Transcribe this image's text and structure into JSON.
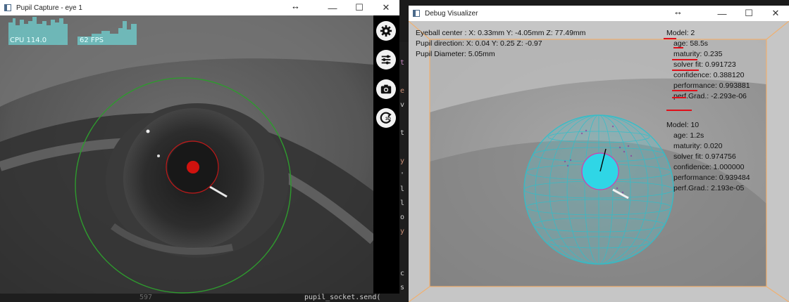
{
  "left_window": {
    "title": "Pupil Capture - eye 1",
    "stats": {
      "cpu_label": "CPU 114.0",
      "fps_label": "62 FPS"
    },
    "sidebar": [
      {
        "name": "settings-button",
        "icon": "gear-icon"
      },
      {
        "name": "plugins-button",
        "icon": "sliders-icon"
      },
      {
        "name": "snapshot-button",
        "icon": "camera-icon"
      },
      {
        "name": "3d-reset-button",
        "icon": "3d-rotate-icon",
        "icon_text": "3D"
      }
    ],
    "colors": {
      "outer_circle": "#2e9a2e",
      "pupil": "#d0120e",
      "stat_graph": "#6fd0d0"
    }
  },
  "right_window": {
    "title": "Debug Visualizer",
    "info": {
      "eyeball_center": "Eyeball center : X: 0.33mm Y: -4.05mm Z: 77.49mm",
      "pupil_direction": "Pupil direction:  X: 0.04 Y: 0.25 Z: -0.97",
      "pupil_diameter": "Pupil Diameter: 5.05mm"
    },
    "models": [
      {
        "title": "Model: 2",
        "lines": [
          "age: 58.5s",
          "maturity: 0.235",
          "solver fit: 0.991723",
          "confidence: 0.388120",
          "performance: 0.993881",
          "perf.Grad.: -2.293e-06"
        ]
      },
      {
        "title": "Model: 10",
        "lines": [
          "age: 1.2s",
          "maturity: 0.020",
          "solver fit: 0.974756",
          "confidence: 1.000000",
          "performance: 0.939484",
          "perf.Grad.: 2.193e-05"
        ]
      }
    ],
    "colors": {
      "sphere": "#2fc0cc",
      "frame": "#f0b070",
      "annotation": "#e0101a"
    }
  },
  "window_controls": {
    "minimize": "—",
    "maximize": "☐",
    "close": "✕",
    "resize": "↔"
  },
  "background_code": {
    "bottom_left": "597",
    "bottom_right": "pupil_socket.send("
  }
}
